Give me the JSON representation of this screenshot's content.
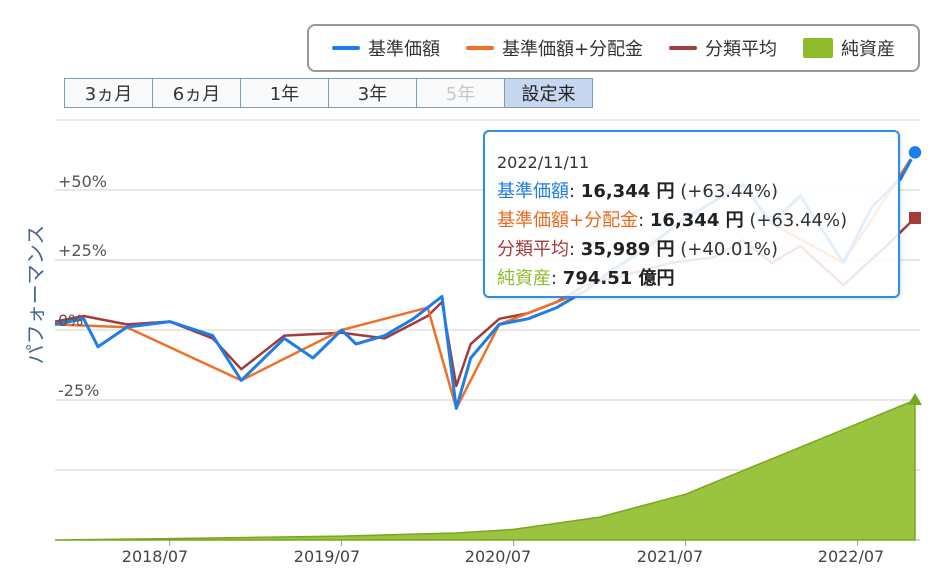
{
  "legend": {
    "items": [
      {
        "label": "基準価額",
        "color": "#1e7de6",
        "kind": "line"
      },
      {
        "label": "基準価額+分配金",
        "color": "#f07028",
        "kind": "line"
      },
      {
        "label": "分類平均",
        "color": "#a33b3b",
        "kind": "line"
      },
      {
        "label": "純資産",
        "color": "#8fbc2b",
        "kind": "area"
      }
    ]
  },
  "ranges": [
    {
      "label": "3ヵ月",
      "state": "normal"
    },
    {
      "label": "6ヵ月",
      "state": "normal"
    },
    {
      "label": "1年",
      "state": "normal"
    },
    {
      "label": "3年",
      "state": "normal"
    },
    {
      "label": "5年",
      "state": "disabled"
    },
    {
      "label": "設定来",
      "state": "active"
    }
  ],
  "yaxis": {
    "title": "パフォーマンス",
    "labels": [
      "+50%",
      "+25%",
      "0%",
      "-25%"
    ]
  },
  "xaxis": {
    "labels": [
      "2018/07",
      "2019/07",
      "2020/07",
      "2021/07",
      "2022/07"
    ]
  },
  "tooltip": {
    "date": "2022/11/11",
    "rows": [
      {
        "name": "基準価額",
        "value": "16,344 円",
        "change": "(+63.44%)",
        "color": "#1e7de6"
      },
      {
        "name": "基準価額+分配金",
        "value": "16,344 円",
        "change": "(+63.44%)",
        "color": "#e86a1c"
      },
      {
        "name": "分類平均",
        "value": "35,989 円",
        "change": "(+40.01%)",
        "color": "#a33b3b"
      },
      {
        "name": "純資産",
        "value": "794.51 億円",
        "change": "",
        "color": "#8fbc2b"
      }
    ]
  },
  "chart_data": {
    "type": "line",
    "x_range": [
      "2017-11",
      "2022-11"
    ],
    "ylim_percent": [
      -50,
      75
    ],
    "series": [
      {
        "name": "基準価額",
        "color": "#1e7de6",
        "x": [
          "2017-11",
          "2018-01",
          "2018-02",
          "2018-04",
          "2018-07",
          "2018-10",
          "2018-12",
          "2019-03",
          "2019-05",
          "2019-07",
          "2019-08",
          "2019-10",
          "2019-12",
          "2020-01",
          "2020-02",
          "2020-03",
          "2020-04",
          "2020-06",
          "2020-08",
          "2020-10",
          "2020-12",
          "2021-02",
          "2021-04",
          "2021-07",
          "2021-09",
          "2021-11",
          "2022-01",
          "2022-03",
          "2022-06",
          "2022-08",
          "2022-10",
          "2022-11"
        ],
        "y": [
          2,
          4,
          -6,
          1,
          3,
          -2,
          -18,
          -3,
          -10,
          0,
          -5,
          -2,
          4,
          8,
          12,
          -28,
          -10,
          2,
          4,
          8,
          14,
          22,
          28,
          40,
          46,
          52,
          38,
          48,
          24,
          44,
          54,
          63.44
        ]
      },
      {
        "name": "基準価額+分配金",
        "color": "#f07028",
        "x": [
          "2017-11",
          "2018-04",
          "2018-12",
          "2019-07",
          "2020-01",
          "2020-03",
          "2020-06",
          "2020-12",
          "2021-07",
          "2021-11",
          "2022-01",
          "2022-06",
          "2022-11"
        ],
        "y": [
          2,
          1,
          -18,
          0,
          8,
          -28,
          2,
          14,
          40,
          52,
          38,
          24,
          63.44
        ]
      },
      {
        "name": "分類平均",
        "color": "#a33b3b",
        "x": [
          "2017-11",
          "2018-01",
          "2018-04",
          "2018-07",
          "2018-10",
          "2018-12",
          "2019-03",
          "2019-07",
          "2019-10",
          "2020-01",
          "2020-02",
          "2020-03",
          "2020-04",
          "2020-06",
          "2020-08",
          "2020-10",
          "2020-12",
          "2021-03",
          "2021-06",
          "2021-09",
          "2021-11",
          "2022-01",
          "2022-03",
          "2022-06",
          "2022-09",
          "2022-11"
        ],
        "y": [
          3,
          5,
          2,
          3,
          -3,
          -14,
          -2,
          -1,
          -3,
          5,
          10,
          -20,
          -5,
          4,
          6,
          10,
          16,
          20,
          24,
          26,
          32,
          24,
          30,
          16,
          30,
          40.01
        ]
      },
      {
        "name": "純資産",
        "color": "#8fbc2b",
        "unit": "億円",
        "x": [
          "2017-11",
          "2018-07",
          "2019-07",
          "2020-03",
          "2020-07",
          "2021-01",
          "2021-07",
          "2022-01",
          "2022-07",
          "2022-11"
        ],
        "y": [
          0,
          8,
          22,
          40,
          60,
          130,
          260,
          460,
          660,
          794.51
        ]
      }
    ]
  }
}
